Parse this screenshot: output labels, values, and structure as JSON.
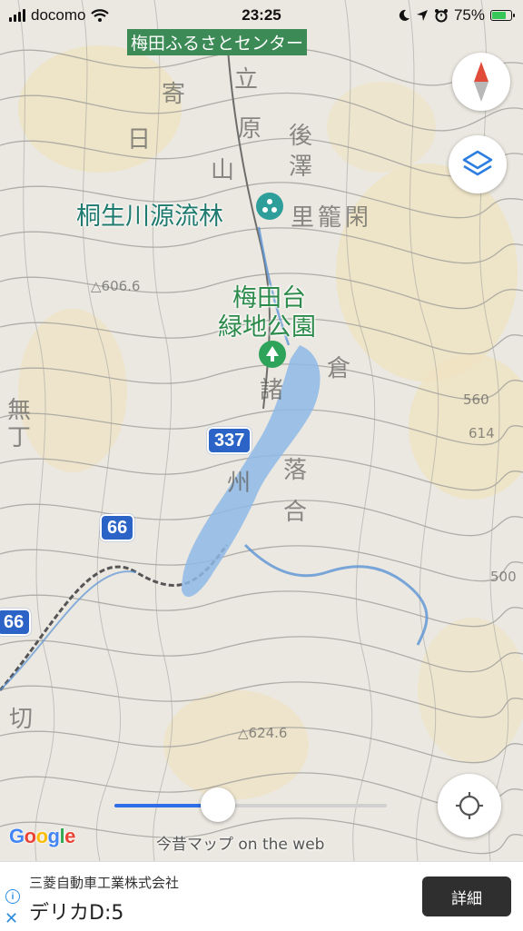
{
  "status_bar": {
    "carrier": "docomo",
    "time": "23:25",
    "battery_percent": "75%",
    "battery_level": 0.75
  },
  "map": {
    "labels": {
      "top_place": "梅田ふるさとセンター",
      "forest_poi": "桐生川源流林",
      "park_line1": "梅田台",
      "park_line2": "緑地公園"
    },
    "road_shields": {
      "route_337": "337",
      "route_66_a": "66",
      "route_66_b": "66"
    },
    "colors": {
      "water": "#8fb8e6",
      "poi_teal": "#2e9e9a",
      "park_green": "#2ea35a",
      "shield_blue": "#2b63c7"
    },
    "time_slider_level": 0.38,
    "google_logo": "Google",
    "attribution": "今昔マップ on the web"
  },
  "ad": {
    "company": "三菱自動車工業株式会社",
    "product": "デリカD:5",
    "button_label": "詳細"
  }
}
